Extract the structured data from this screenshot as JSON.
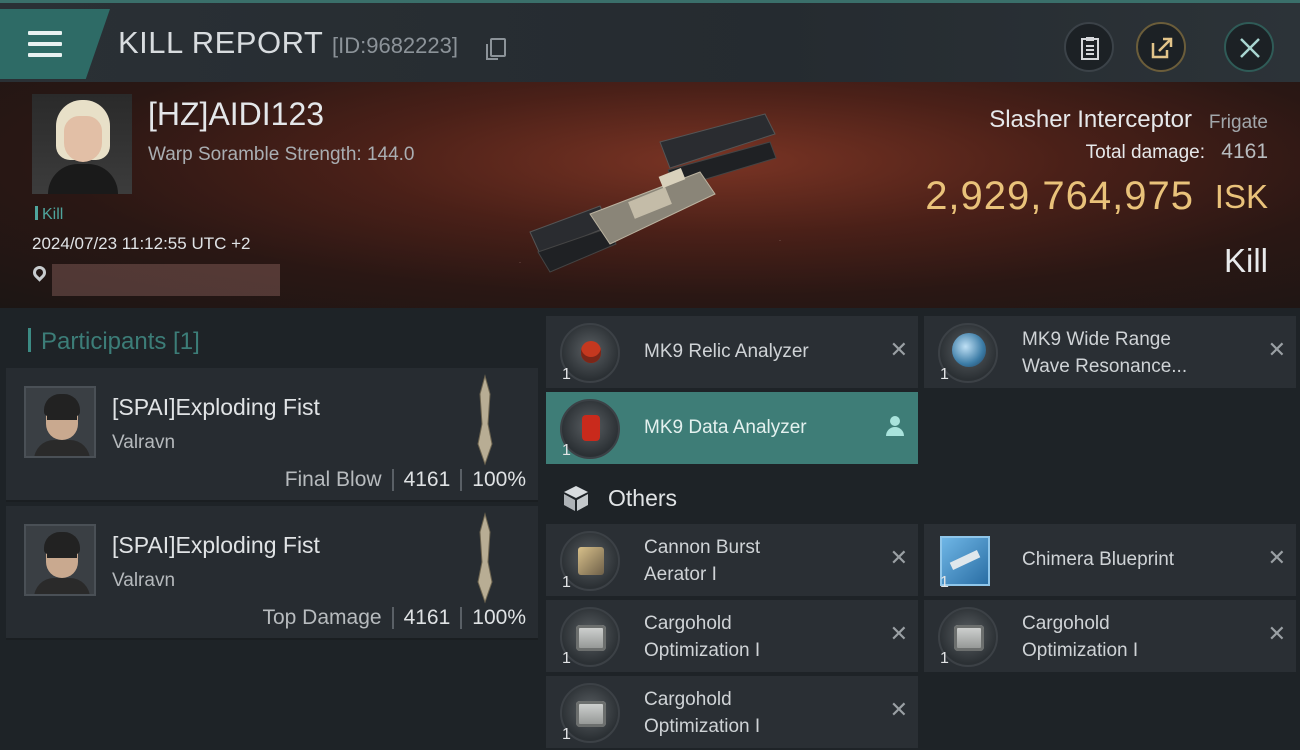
{
  "header": {
    "title": "KILL REPORT",
    "id_text": "[ID:9682223]"
  },
  "victim": {
    "name": "[HZ]AIDI123",
    "warp_text": "Warp Soramble Strength: 144.0",
    "tag": "Kill",
    "timestamp": "2024/07/23 11:12:55 UTC +2"
  },
  "ship": {
    "name": "Slasher Interceptor",
    "class": "Frigate",
    "damage_label": "Total damage:",
    "damage_value": "4161",
    "isk_value": "2,929,764,975",
    "isk_unit": "ISK",
    "result": "Kill"
  },
  "participants": {
    "title": "Participants [1]",
    "rows": [
      {
        "name": "[SPAI]Exploding Fist",
        "corp": "Valravn",
        "label": "Final Blow",
        "damage": "4161",
        "percent": "100%"
      },
      {
        "name": "[SPAI]Exploding Fist",
        "corp": "Valravn",
        "label": "Top Damage",
        "damage": "4161",
        "percent": "100%"
      }
    ]
  },
  "items": {
    "top": [
      {
        "line1": "MK9 Relic Analyzer",
        "line2": "",
        "qty": "1",
        "icon": "relic-analyzer-icon"
      },
      {
        "line1": "MK9 Wide Range",
        "line2": "Wave Resonance...",
        "qty": "1",
        "icon": "wave-resonance-icon"
      },
      {
        "line1": "MK9 Data Analyzer",
        "line2": "",
        "qty": "1",
        "icon": "data-analyzer-icon",
        "selected": true
      }
    ],
    "others_label": "Others",
    "others": [
      {
        "line1": "Cannon Burst",
        "line2": "Aerator I",
        "qty": "1",
        "icon": "cannon-burst-icon"
      },
      {
        "line1": "Chimera Blueprint",
        "line2": "",
        "qty": "1",
        "icon": "blueprint-icon"
      },
      {
        "line1": "Cargohold",
        "line2": "Optimization I",
        "qty": "1",
        "icon": "cargohold-icon"
      },
      {
        "line1": "Cargohold",
        "line2": "Optimization I",
        "qty": "1",
        "icon": "cargohold-icon"
      },
      {
        "line1": "Cargohold",
        "line2": "Optimization I",
        "qty": "1",
        "icon": "cargohold-icon"
      }
    ]
  },
  "colors": {
    "accent": "#3e7d77",
    "isk_gold": "#e9c27a"
  }
}
